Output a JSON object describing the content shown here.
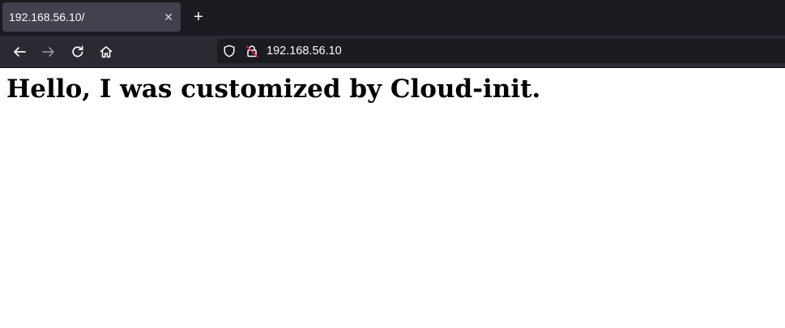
{
  "browser": {
    "tab": {
      "title": "192.168.56.10/",
      "close_glyph": "✕"
    },
    "new_tab_glyph": "+",
    "nav": {
      "back_icon": "arrow-left-icon",
      "forward_icon": "arrow-right-icon",
      "reload_icon": "reload-icon",
      "home_icon": "home-icon"
    },
    "urlbar": {
      "url": "192.168.56.10",
      "tracking_icon": "shield-icon",
      "security_icon": "insecure-lock-icon"
    },
    "colors": {
      "tabbar_bg": "#1c1b22",
      "active_tab_bg": "#42414d",
      "toolbar_bg": "#2b2a33",
      "urlbar_bg": "#1c1b22",
      "insecure_accent": "#e22850"
    }
  },
  "page": {
    "heading": "Hello, I was customized by Cloud-init."
  }
}
